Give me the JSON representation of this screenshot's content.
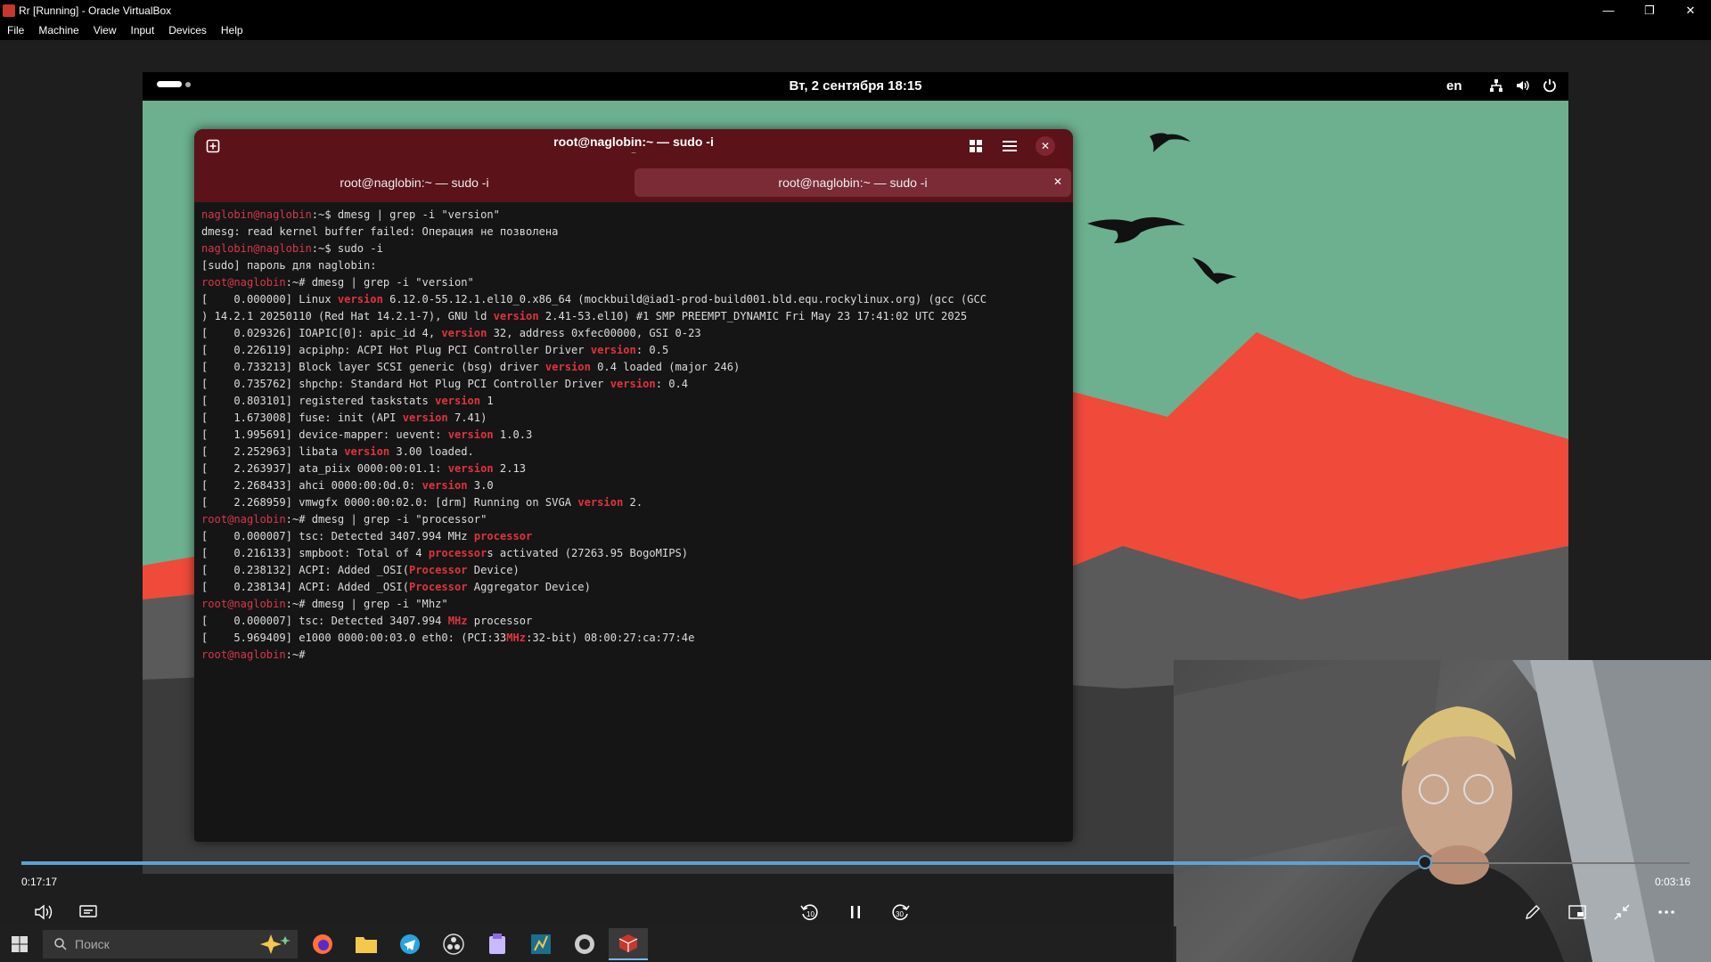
{
  "window": {
    "title": "Rr [Running] - Oracle VirtualBox",
    "controls": [
      "minimize",
      "restore",
      "close"
    ]
  },
  "menubar": [
    "File",
    "Machine",
    "View",
    "Input",
    "Devices",
    "Help"
  ],
  "guest": {
    "topbar": {
      "clock": "Вт, 2 сентября  18:15",
      "language": "en"
    },
    "terminal": {
      "title": "root@naglobin:~ — sudo -i",
      "subtitle": "~",
      "tabs": [
        "root@naglobin:~ — sudo -i",
        "root@naglobin:~ — sudo -i"
      ]
    }
  },
  "player": {
    "elapsed": "0:17:17",
    "remaining": "0:03:16",
    "progress": 0.842
  },
  "taskbar": {
    "search_placeholder": "Поиск"
  },
  "colors": {
    "terminal_header": "#5b1219",
    "prompt_red": "#d9384a",
    "match_highlight": "#e0333f",
    "seek_accent": "#5aa3d6",
    "wallpaper_sky": "#6cb08f",
    "wallpaper_mountain": "#ef4a3a"
  },
  "terminal_lines": [
    [
      {
        "t": "naglobin@naglobin",
        "c": "pr"
      },
      {
        "t": ":~$ dmesg | grep -i \"version\""
      }
    ],
    [
      {
        "t": "dmesg: read kernel buffer failed: Операция не позволена"
      }
    ],
    [
      {
        "t": "naglobin@naglobin",
        "c": "pr"
      },
      {
        "t": ":~$ sudo -i"
      }
    ],
    [
      {
        "t": "[sudo] пароль для naglobin:"
      }
    ],
    [
      {
        "t": "root@naglobin",
        "c": "pr"
      },
      {
        "t": ":~# dmesg | grep -i \"version\""
      }
    ],
    [
      {
        "t": "[    0.000000] Linux "
      },
      {
        "t": "version",
        "c": "hl"
      },
      {
        "t": " 6.12.0-55.12.1.el10_0.x86_64 (mockbuild@iad1-prod-build001.bld.equ.rockylinux.org) (gcc (GCC"
      }
    ],
    [
      {
        "t": ") 14.2.1 20250110 (Red Hat 14.2.1-7), GNU ld "
      },
      {
        "t": "version",
        "c": "hl"
      },
      {
        "t": " 2.41-53.el10) #1 SMP PREEMPT_DYNAMIC Fri May 23 17:41:02 UTC 2025"
      }
    ],
    [
      {
        "t": "[    0.029326] IOAPIC[0]: apic_id 4, "
      },
      {
        "t": "version",
        "c": "hl"
      },
      {
        "t": " 32, address 0xfec00000, GSI 0-23"
      }
    ],
    [
      {
        "t": "[    0.226119] acpiphp: ACPI Hot Plug PCI Controller Driver "
      },
      {
        "t": "version",
        "c": "hl"
      },
      {
        "t": ": 0.5"
      }
    ],
    [
      {
        "t": "[    0.733213] Block layer SCSI generic (bsg) driver "
      },
      {
        "t": "version",
        "c": "hl"
      },
      {
        "t": " 0.4 loaded (major 246)"
      }
    ],
    [
      {
        "t": "[    0.735762] shpchp: Standard Hot Plug PCI Controller Driver "
      },
      {
        "t": "version",
        "c": "hl"
      },
      {
        "t": ": 0.4"
      }
    ],
    [
      {
        "t": "[    0.803101] registered taskstats "
      },
      {
        "t": "version",
        "c": "hl"
      },
      {
        "t": " 1"
      }
    ],
    [
      {
        "t": "[    1.673008] fuse: init (API "
      },
      {
        "t": "version",
        "c": "hl"
      },
      {
        "t": " 7.41)"
      }
    ],
    [
      {
        "t": "[    1.995691] device-mapper: uevent: "
      },
      {
        "t": "version",
        "c": "hl"
      },
      {
        "t": " 1.0.3"
      }
    ],
    [
      {
        "t": "[    2.252963] libata "
      },
      {
        "t": "version",
        "c": "hl"
      },
      {
        "t": " 3.00 loaded."
      }
    ],
    [
      {
        "t": "[    2.263937] ata_piix 0000:00:01.1: "
      },
      {
        "t": "version",
        "c": "hl"
      },
      {
        "t": " 2.13"
      }
    ],
    [
      {
        "t": "[    2.268433] ahci 0000:00:0d.0: "
      },
      {
        "t": "version",
        "c": "hl"
      },
      {
        "t": " 3.0"
      }
    ],
    [
      {
        "t": "[    2.268959] vmwgfx 0000:00:02.0: [drm] Running on SVGA "
      },
      {
        "t": "version",
        "c": "hl"
      },
      {
        "t": " 2."
      }
    ],
    [
      {
        "t": "root@naglobin",
        "c": "pr"
      },
      {
        "t": ":~# dmesg | grep -i \"processor\""
      }
    ],
    [
      {
        "t": "[    0.000007] tsc: Detected 3407.994 MHz "
      },
      {
        "t": "processor",
        "c": "hl"
      }
    ],
    [
      {
        "t": "[    0.216133] smpboot: Total of 4 "
      },
      {
        "t": "processor",
        "c": "hl"
      },
      {
        "t": "s activated (27263.95 BogoMIPS)"
      }
    ],
    [
      {
        "t": "[    0.238132] ACPI: Added _OSI("
      },
      {
        "t": "Processor",
        "c": "hl"
      },
      {
        "t": " Device)"
      }
    ],
    [
      {
        "t": "[    0.238134] ACPI: Added _OSI("
      },
      {
        "t": "Processor",
        "c": "hl"
      },
      {
        "t": " Aggregator Device)"
      }
    ],
    [
      {
        "t": "root@naglobin",
        "c": "pr"
      },
      {
        "t": ":~# dmesg | grep -i \"Mhz\""
      }
    ],
    [
      {
        "t": "[    0.000007] tsc: Detected 3407.994 "
      },
      {
        "t": "MHz",
        "c": "hl"
      },
      {
        "t": " processor"
      }
    ],
    [
      {
        "t": "[    5.969409] e1000 0000:00:03.0 eth0: (PCI:33"
      },
      {
        "t": "MHz",
        "c": "hl"
      },
      {
        "t": ":32-bit) 08:00:27:ca:77:4e"
      }
    ],
    [
      {
        "t": "root@naglobin",
        "c": "pr"
      },
      {
        "t": ":~#"
      }
    ]
  ]
}
